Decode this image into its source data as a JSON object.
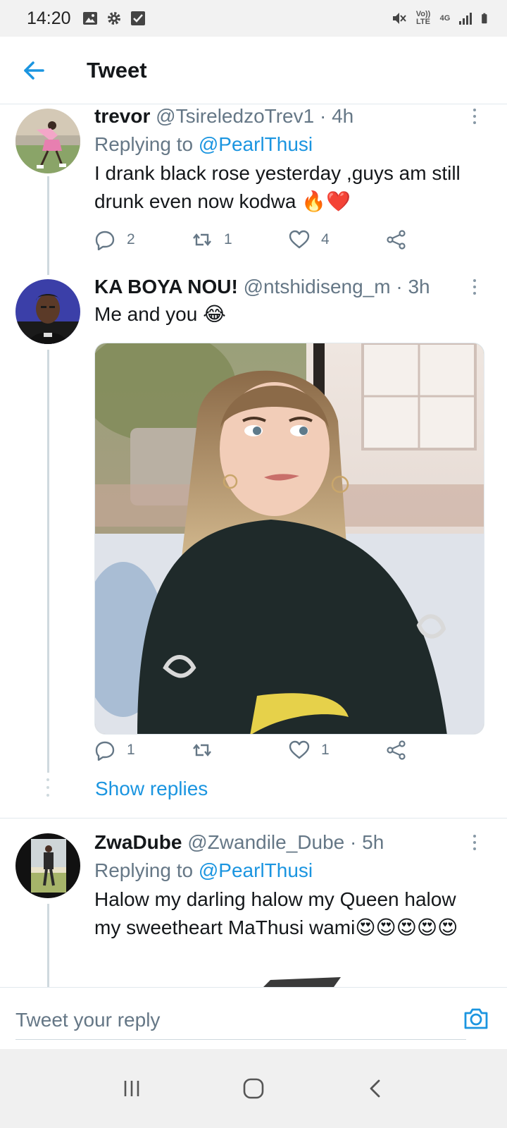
{
  "status_bar": {
    "time": "14:20",
    "icons": [
      "image-icon",
      "gear-icon",
      "checkbox-icon",
      "mute-icon",
      "volte-icon",
      "4g-icon",
      "signal-icon",
      "battery-icon"
    ],
    "volte_text": "Vo)) LTE",
    "network_text": "4G"
  },
  "header": {
    "title": "Tweet"
  },
  "tweets": [
    {
      "name": "trevor",
      "handle": "@TsireledzoTrev1",
      "separator": "·",
      "time": "4h",
      "replying_prefix": "Replying to",
      "replying_to": "@PearlThusi",
      "text": "I drank black rose yesterday ,guys am still drunk even now kodwa 🔥❤️",
      "replies": "2",
      "retweets": "1",
      "likes": "4"
    },
    {
      "name": "KA BOYA NOU!",
      "handle": "@ntshidiseng_m",
      "separator": "·",
      "time": "3h",
      "text": "Me and you 😂",
      "replies": "1",
      "retweets": "",
      "likes": "1",
      "show_replies": "Show replies"
    },
    {
      "name": "ZwaDube",
      "handle": "@Zwandile_Dube",
      "separator": "·",
      "time": "5h",
      "replying_prefix": "Replying to",
      "replying_to": "@PearlThusi",
      "text": "Halow my darling halow my Queen halow my sweetheart MaThusi wami😍😍😍😍😍"
    }
  ],
  "reply_bar": {
    "placeholder": "Tweet your reply"
  },
  "colors": {
    "accent": "#1b95e0",
    "secondary_text": "#657786",
    "divider": "#e1e8ed"
  }
}
